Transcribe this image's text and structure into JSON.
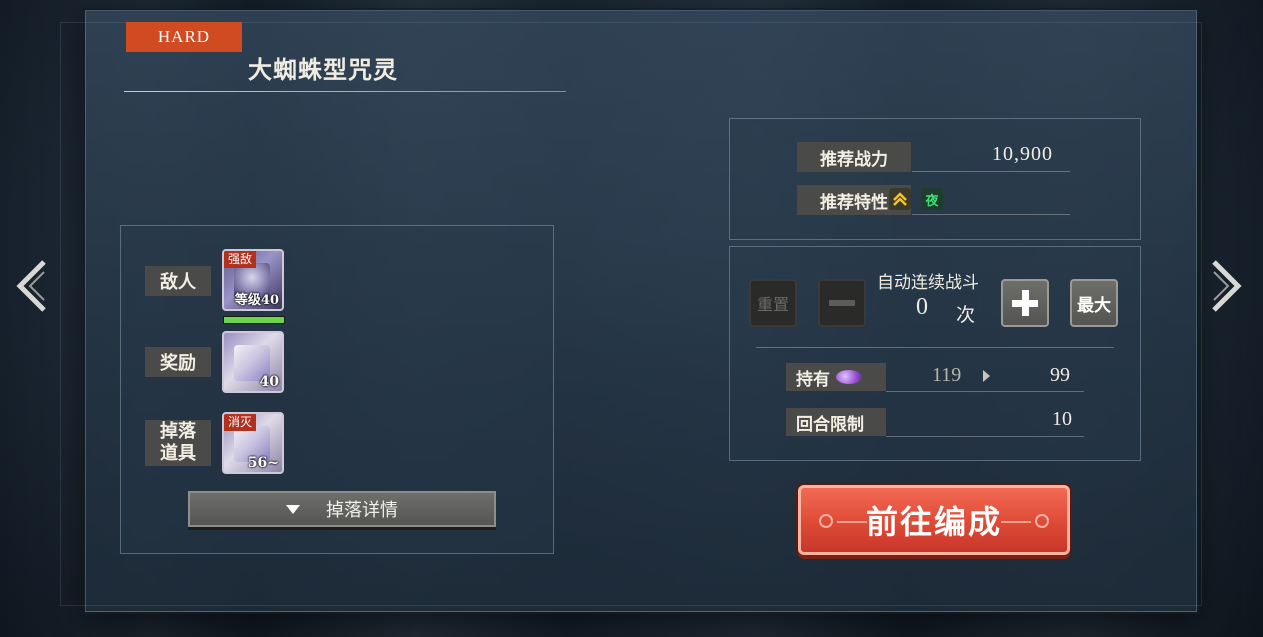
{
  "stage": {
    "difficulty": "HARD",
    "title": "大蜘蛛型咒灵"
  },
  "left_panel": {
    "enemy_label": "敌人",
    "enemy_badge": "强敌",
    "enemy_level": "等级40",
    "enemy_hp_percent": 100,
    "reward_label": "奖励",
    "reward_count": "40",
    "drop_label_line1": "掉落",
    "drop_label_line2": "道具",
    "drop_badge": "消灭",
    "drop_count": "56~",
    "details_button": "掉落详情"
  },
  "recommend": {
    "power_label": "推荐战力",
    "power_value": "10,900",
    "trait_label": "推荐特性",
    "trait_icons": [
      "chevron-up-icon",
      "night-trait-icon"
    ],
    "trait_night_glyph": "夜"
  },
  "auto_battle": {
    "reset_label": "重置",
    "title": "自动连续战斗",
    "count": "0",
    "unit": "次",
    "max_label": "最大"
  },
  "stats": {
    "held_label": "持有",
    "held_current": "119",
    "held_after": "99",
    "turn_limit_label": "回合限制",
    "turn_limit_value": "10"
  },
  "go_button": "前往编成",
  "colors": {
    "difficulty_tag": "#d04a22",
    "go_button": "#de4a36",
    "hp_bar": "#6ed24a",
    "label_bg": "#4a4a48"
  }
}
